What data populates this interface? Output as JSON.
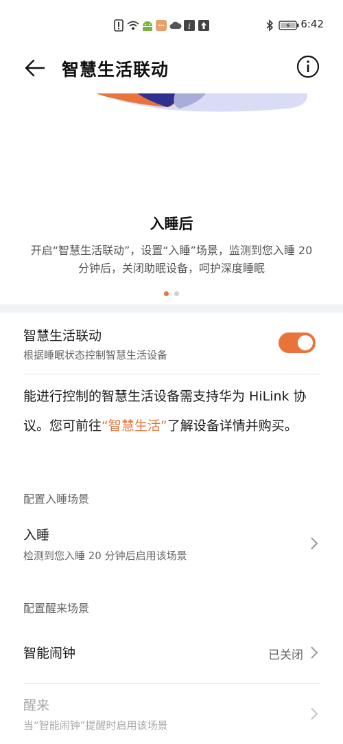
{
  "status_bar": {
    "time": "6:42",
    "icons": [
      "alert-icon",
      "wifi-icon",
      "android-icon",
      "message-icon",
      "cloud-icon",
      "info-square-icon",
      "upload-icon",
      "bluetooth-icon",
      "battery-icon"
    ]
  },
  "header": {
    "title": "智慧生活联动"
  },
  "hero": {
    "title": "入睡后",
    "description": "开启“智慧生活联动”，设置“入睡”场景，监测到您入睡 20 分钟后，关闭助眠设备，呵护深度睡眠",
    "page_index": 1,
    "page_count": 2
  },
  "linkage": {
    "title": "智慧生活联动",
    "subtitle": "根据睡眠状态控制智慧生活设备",
    "enabled": true
  },
  "notice": {
    "text_before": "能进行控制的智慧生活设备需支持华为 HiLink 协议。您可前往",
    "link_text": "“智慧生活”",
    "text_after": "了解设备详情并购买。"
  },
  "sleep_section": {
    "label": "配置入睡场景",
    "item_title": "入睡",
    "item_subtitle": "检测到您入睡 20 分钟后启用该场景"
  },
  "wake_section": {
    "label": "配置醒来场景",
    "alarm_title": "智能闹钟",
    "alarm_value": "已关闭",
    "wake_title": "醒来",
    "wake_subtitle": "当“智能闹钟”提醒时启用该场景"
  },
  "colors": {
    "accent": "#e8743b",
    "text": "#1a1a1a",
    "muted": "#666666",
    "disabled": "#a8a8a8"
  }
}
